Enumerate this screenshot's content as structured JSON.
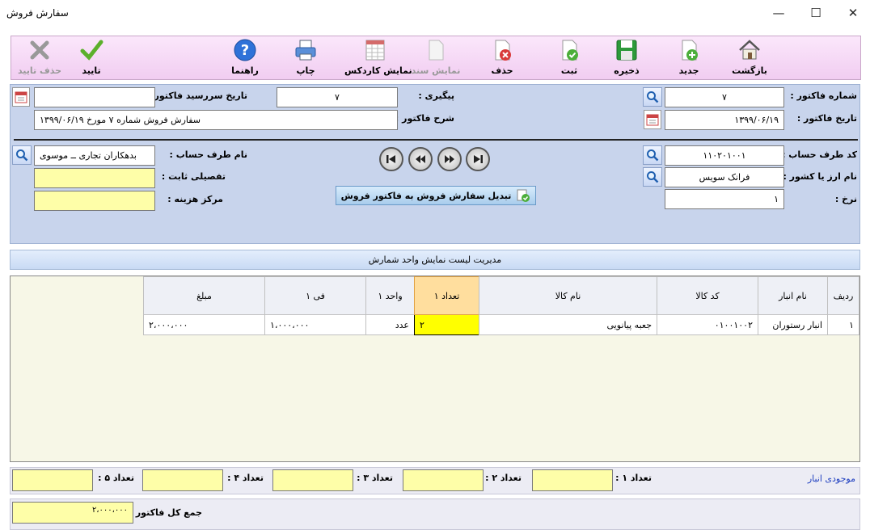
{
  "window": {
    "title": "سفارش فروش"
  },
  "toolbar": {
    "back": "بازگشت",
    "new": "جدید",
    "save": "ذخیره",
    "register": "ثبت",
    "delete": "حذف",
    "show_document": "نمایش سند",
    "show_cardex": "نمایش کاردکس",
    "print": "چاپ",
    "help": "راهنما",
    "confirm": "تایید",
    "delete_confirm": "حذف تایید"
  },
  "header": {
    "invoice_number_label": "شماره فاکتور :",
    "invoice_number": "۷",
    "invoice_date_label": "تاریخ فاکتور :",
    "invoice_date": "۱۳۹۹/۰۶/۱۹",
    "tracking_label": "پیگیری :",
    "tracking": "۷",
    "due_date_label": "تاریخ سررسید فاکتور :",
    "due_date": "",
    "description_label": "شرح فاکتور :",
    "description": "سفارش فروش شماره ۷ مورخ ۱۳۹۹/۰۶/۱۹"
  },
  "account": {
    "code_label": "کد طرف حساب :",
    "code": "۱۱۰۲۰۱۰۰۱",
    "name_label": "نام طرف حساب :",
    "name": "بدهکاران تجاری ــ موسوی",
    "currency_label": "نام ارز یا کشور :",
    "currency": "فرانک سویس",
    "rate_label": "نرخ :",
    "rate": "۱",
    "detail_label": "تفصیلی ثابت :",
    "detail": "",
    "cost_center_label": "مرکز هزینه :",
    "cost_center": ""
  },
  "convert_button": "تبدیل سفارش فروش به فاکتور فروش",
  "units_bar": "مدیریت لیست نمایش واحد شمارش",
  "grid": {
    "columns": [
      "ردیف",
      "نام انبار",
      "کد کالا",
      "نام کالا",
      "تعداد ۱",
      "واحد ۱",
      "فی ۱",
      "مبلغ"
    ],
    "rows": [
      [
        "۱",
        "انبار رستوران",
        "۰۱۰۰۱۰۰۲",
        "جعبه پیانویی",
        "۲",
        "عدد",
        "۱،۰۰۰،۰۰۰",
        "۲،۰۰۰،۰۰۰"
      ]
    ]
  },
  "stock": {
    "label": "موجودی انبار",
    "q1_label": "تعداد ۱ :",
    "q2_label": "تعداد ۲ :",
    "q3_label": "تعداد ۳ :",
    "q4_label": "تعداد ۴ :",
    "q5_label": "تعداد ۵ :"
  },
  "total": {
    "label": "جمع کل فاکتور :",
    "value": "۲،۰۰۰،۰۰۰"
  }
}
